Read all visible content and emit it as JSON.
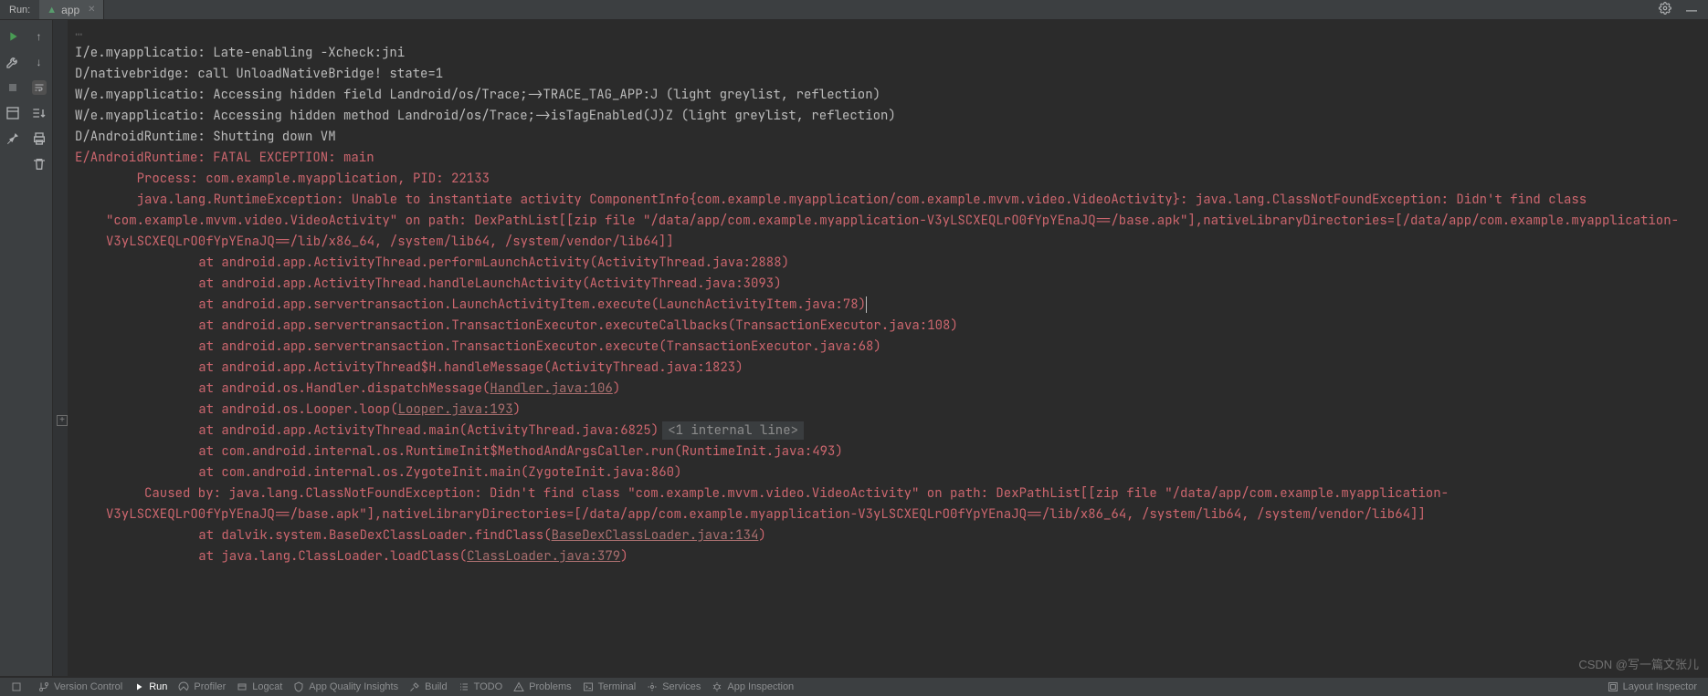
{
  "topbar": {
    "label": "Run:",
    "tab": {
      "name": "app",
      "icon": "android"
    }
  },
  "console": {
    "lines": [
      {
        "cls": "gray",
        "indent": 0,
        "text": "I/e.myapplicatio: Late-enabling -Xcheck:jni"
      },
      {
        "cls": "gray",
        "indent": 0,
        "text": "D/nativebridge: call UnloadNativeBridge! state=1"
      },
      {
        "cls": "gray",
        "indent": 0,
        "text": "W/e.myapplicatio: Accessing hidden field Landroid/os/Trace;->TRACE_TAG_APP:J (light greylist, reflection)"
      },
      {
        "cls": "gray",
        "indent": 0,
        "text": "W/e.myapplicatio: Accessing hidden method Landroid/os/Trace;->isTagEnabled(J)Z (light greylist, reflection)"
      },
      {
        "cls": "gray",
        "indent": 0,
        "text": "D/AndroidRuntime: Shutting down VM"
      },
      {
        "cls": "err",
        "indent": 0,
        "text": "E/AndroidRuntime: FATAL EXCEPTION: main"
      },
      {
        "cls": "err",
        "indent": 1,
        "text": "Process: com.example.myapplication, PID: 22133"
      },
      {
        "cls": "err",
        "indent": 1,
        "text": "java.lang.RuntimeException: Unable to instantiate activity ComponentInfo{com.example.myapplication/com.example.mvvm.video.VideoActivity}: java.lang.ClassNotFoundException: Didn't find class \"com.example.mvvm.video.VideoActivity\" on path: DexPathList[[zip file \"/data/app/com.example.myapplication-V3yLSCXEQLrO0fYpYEnaJQ==/base.apk\"],nativeLibraryDirectories=[/data/app/com.example.myapplication-V3yLSCXEQLrO0fYpYEnaJQ==/lib/x86_64, /system/lib64, /system/vendor/lib64]]"
      },
      {
        "cls": "err",
        "indent": 2,
        "text": "at android.app.ActivityThread.performLaunchActivity(ActivityThread.java:2888)"
      },
      {
        "cls": "err",
        "indent": 2,
        "text": "at android.app.ActivityThread.handleLaunchActivity(ActivityThread.java:3093)"
      },
      {
        "cls": "err",
        "indent": 2,
        "caret": true,
        "text": "at android.app.servertransaction.LaunchActivityItem.execute(LaunchActivityItem.java:78)"
      },
      {
        "cls": "err",
        "indent": 2,
        "text": "at android.app.servertransaction.TransactionExecutor.executeCallbacks(TransactionExecutor.java:108)"
      },
      {
        "cls": "err",
        "indent": 2,
        "text": "at android.app.servertransaction.TransactionExecutor.execute(TransactionExecutor.java:68)"
      },
      {
        "cls": "err",
        "indent": 2,
        "text": "at android.app.ActivityThread$H.handleMessage(ActivityThread.java:1823)"
      },
      {
        "cls": "err",
        "indent": 2,
        "text": "at android.os.Handler.dispatchMessage(",
        "link": "Handler.java:106",
        "tail": ")"
      },
      {
        "cls": "err",
        "indent": 2,
        "text": "at android.os.Looper.loop(",
        "link": "Looper.java:193",
        "tail": ")"
      },
      {
        "cls": "err",
        "indent": 2,
        "text": "at android.app.ActivityThread.main(ActivityThread.java:6825)",
        "hint": "<1 internal line>"
      },
      {
        "cls": "err",
        "indent": 2,
        "text": "at com.android.internal.os.RuntimeInit$MethodAndArgsCaller.run(RuntimeInit.java:493)"
      },
      {
        "cls": "err",
        "indent": 2,
        "text": "at com.android.internal.os.ZygoteInit.main(ZygoteInit.java:860)"
      },
      {
        "cls": "err",
        "indent": 1,
        "text": " Caused by: java.lang.ClassNotFoundException: Didn't find class \"com.example.mvvm.video.VideoActivity\" on path: DexPathList[[zip file \"/data/app/com.example.myapplication-V3yLSCXEQLrO0fYpYEnaJQ==/base.apk\"],nativeLibraryDirectories=[/data/app/com.example.myapplication-V3yLSCXEQLrO0fYpYEnaJQ==/lib/x86_64, /system/lib64, /system/vendor/lib64]]"
      },
      {
        "cls": "err",
        "indent": 2,
        "text": "at dalvik.system.BaseDexClassLoader.findClass(",
        "link": "BaseDexClassLoader.java:134",
        "tail": ")"
      },
      {
        "cls": "err",
        "indent": 2,
        "text": "at java.lang.ClassLoader.loadClass(",
        "link": "ClassLoader.java:379",
        "tail": ")"
      }
    ],
    "truncated_top": "…"
  },
  "bottom": {
    "items": [
      {
        "id": "vcs",
        "label": "Version Control",
        "icon": "branch"
      },
      {
        "id": "run",
        "label": "Run",
        "icon": "play",
        "active": true
      },
      {
        "id": "profiler",
        "label": "Profiler",
        "icon": "meter"
      },
      {
        "id": "logcat",
        "label": "Logcat",
        "icon": "cat"
      },
      {
        "id": "aqi",
        "label": "App Quality Insights",
        "icon": "shield"
      },
      {
        "id": "build",
        "label": "Build",
        "icon": "hammer"
      },
      {
        "id": "todo",
        "label": "TODO",
        "icon": "list"
      },
      {
        "id": "problems",
        "label": "Problems",
        "icon": "warn"
      },
      {
        "id": "terminal",
        "label": "Terminal",
        "icon": "term"
      },
      {
        "id": "services",
        "label": "Services",
        "icon": "svc"
      },
      {
        "id": "appinsp",
        "label": "App Inspection",
        "icon": "bug"
      }
    ],
    "right": {
      "label": "Layout Inspector",
      "icon": "layout"
    }
  },
  "watermark": "CSDN @写一篇文张儿"
}
